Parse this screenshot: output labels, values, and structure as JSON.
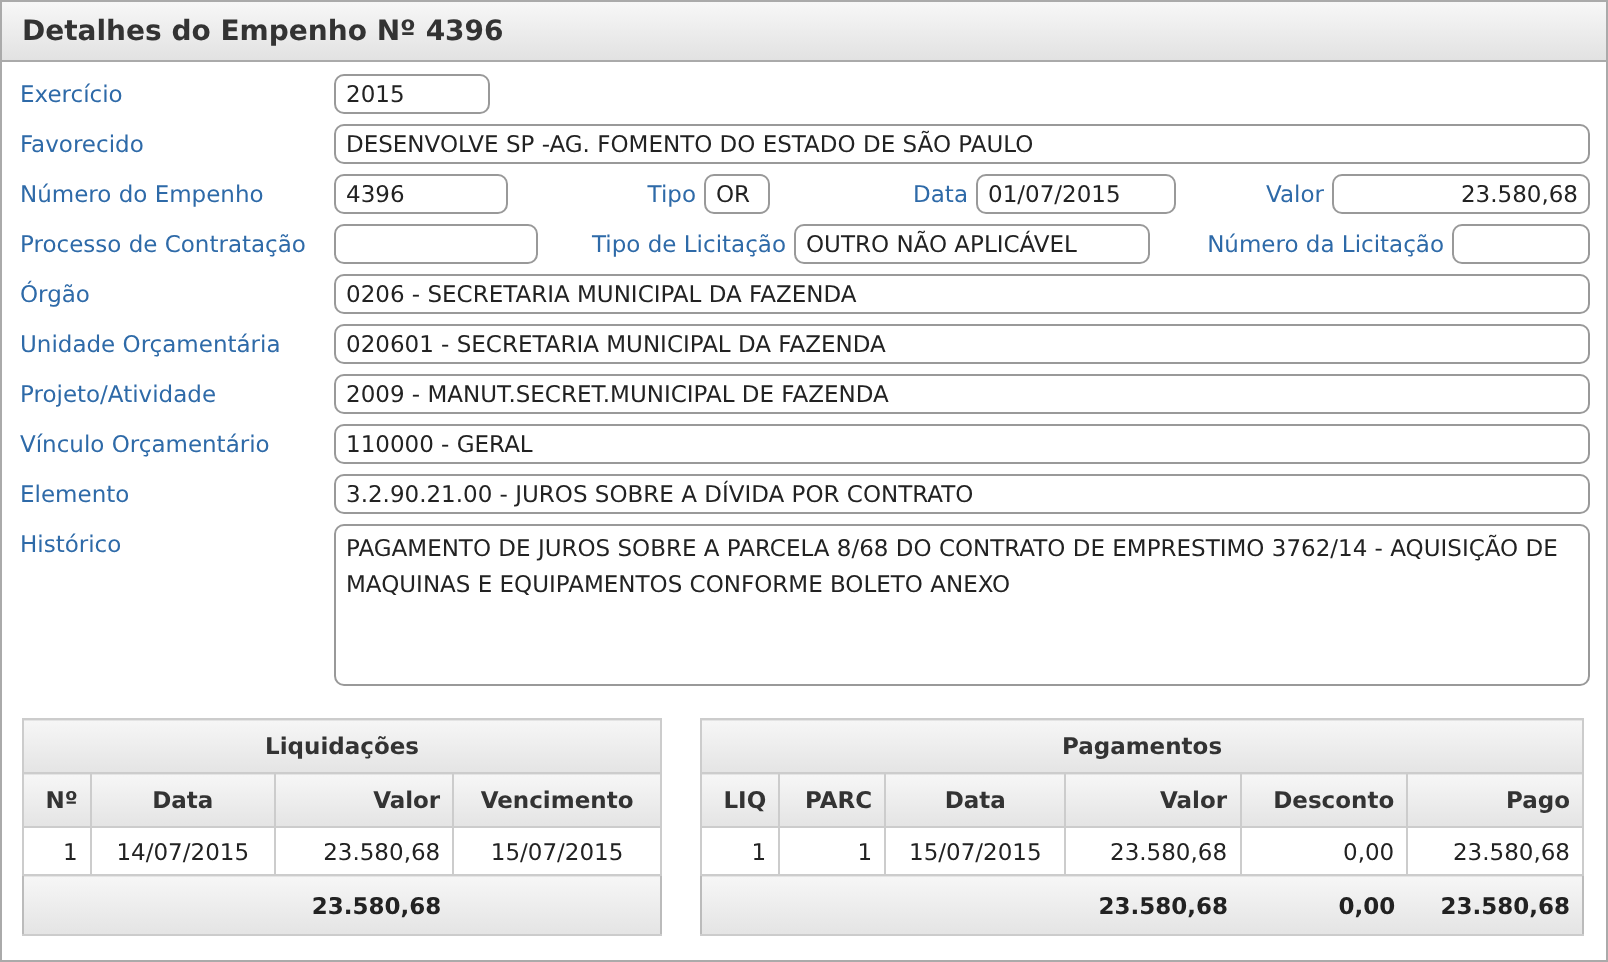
{
  "panel": {
    "title": "Detalhes do Empenho Nº 4396"
  },
  "form_rows": [
    {
      "cells": [
        {
          "label": "Exercício",
          "value": "2015",
          "kind": "short"
        }
      ]
    },
    {
      "cells": [
        {
          "label": "Favorecido",
          "value": "DESENVOLVE SP -AG. FOMENTO DO ESTADO DE SÃO PAULO",
          "kind": "text"
        }
      ]
    },
    {
      "cells": [
        {
          "label": "Número do Empenho",
          "value": "4396",
          "kind": "text"
        },
        {
          "label": "Tipo",
          "value": "OR",
          "kind": "text"
        },
        {
          "label": "Data",
          "value": "01/07/2015",
          "kind": "text"
        },
        {
          "label": "Valor",
          "value": "23.580,68",
          "kind": "money"
        }
      ]
    },
    {
      "cells": [
        {
          "label": "Processo de Contratação",
          "kind": "text"
        },
        {
          "label": "Tipo de Licitação",
          "value": "OUTRO NÃO APLICÁVEL",
          "kind": "text"
        },
        {
          "label": "Número da Licitação",
          "kind": "text"
        }
      ]
    },
    {
      "cells": [
        {
          "label": "Órgão",
          "value": "0206 - SECRETARIA MUNICIPAL DA FAZENDA",
          "kind": "text"
        }
      ]
    },
    {
      "cells": [
        {
          "label": "Unidade Orçamentária",
          "value": "020601 - SECRETARIA MUNICIPAL DA FAZENDA",
          "kind": "text"
        }
      ]
    },
    {
      "cells": [
        {
          "label": "Projeto/Atividade",
          "value": "2009 - MANUT.SECRET.MUNICIPAL DE FAZENDA",
          "kind": "text"
        }
      ]
    },
    {
      "cells": [
        {
          "label": "Vínculo Orçamentário",
          "value": "110000 - GERAL",
          "kind": "text"
        }
      ]
    },
    {
      "cells": [
        {
          "label": "Elemento",
          "value": "3.2.90.21.00 - JUROS SOBRE A DÍVIDA POR CONTRATO",
          "kind": "text"
        }
      ]
    },
    {
      "cells": [
        {
          "label": "Histórico",
          "value": "PAGAMENTO DE JUROS SOBRE A PARCELA 8/68 DO CONTRATO DE EMPRESTIMO 3762/14 - AQUISIÇÃO DE MAQUINAS E EQUIPAMENTOS CONFORME BOLETO ANEXO",
          "kind": "multiline"
        }
      ]
    }
  ],
  "tables": [
    {
      "title": "Liquidações",
      "columns": [
        {
          "label": "Nº",
          "kind": "number"
        },
        {
          "label": "Data",
          "kind": "date"
        },
        {
          "label": "Valor",
          "kind": "number",
          "total": "23.580,68"
        },
        {
          "label": "Vencimento",
          "kind": "date"
        }
      ],
      "rows": [
        [
          "1",
          "14/07/2015",
          "23.580,68",
          "15/07/2015"
        ]
      ]
    },
    {
      "title": "Pagamentos",
      "columns": [
        {
          "label": "LIQ",
          "kind": "number"
        },
        {
          "label": "PARC",
          "kind": "number"
        },
        {
          "label": "Data",
          "kind": "date"
        },
        {
          "label": "Valor",
          "kind": "number",
          "total": "23.580,68"
        },
        {
          "label": "Desconto",
          "kind": "number",
          "total": "0,00"
        },
        {
          "label": "Pago",
          "kind": "number",
          "total": "23.580,68"
        }
      ],
      "rows": [
        [
          "1",
          "1",
          "15/07/2015",
          "23.580,68",
          "0,00",
          "23.580,68"
        ]
      ]
    }
  ]
}
